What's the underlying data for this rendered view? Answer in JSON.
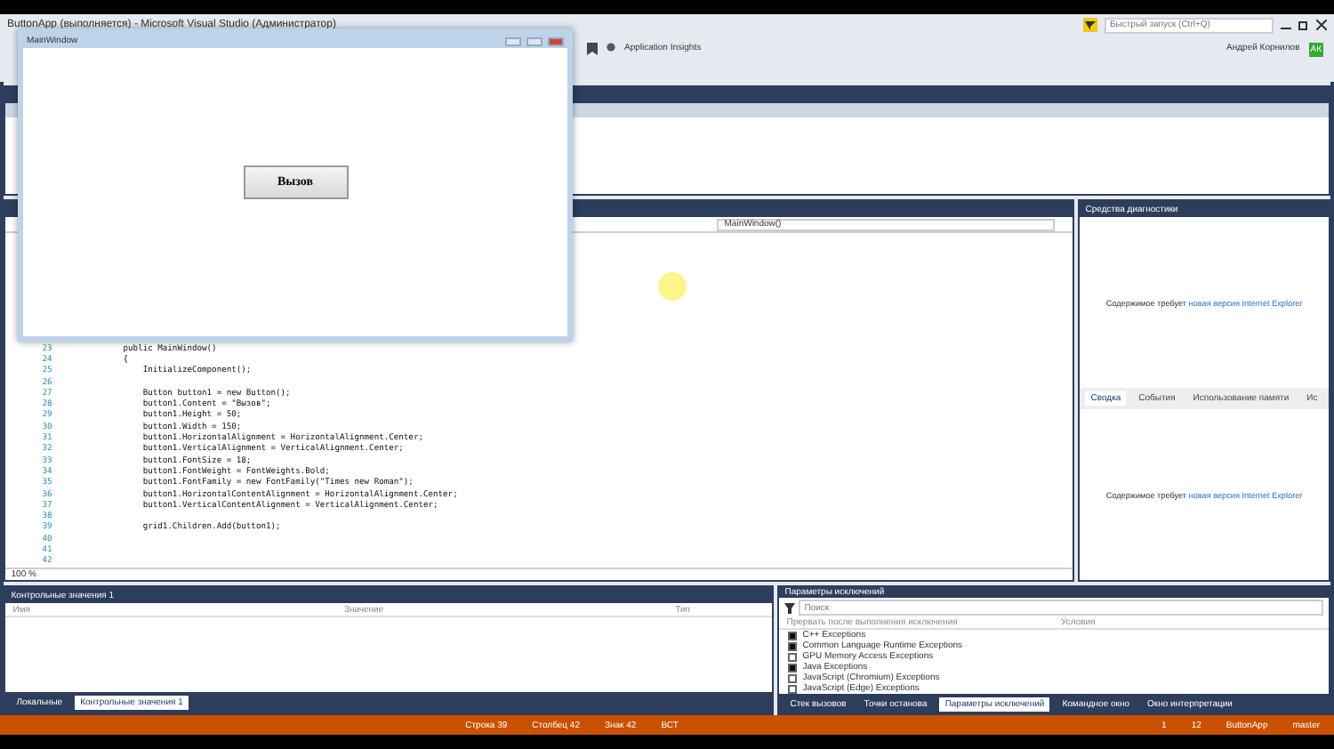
{
  "title": "ButtonApp (выполняется) - Microsoft Visual Studio (Администратор)",
  "search": {
    "placeholder": "Быстрый запуск (Ctrl+Q)"
  },
  "toolbar": {
    "app_insights": "Application Insights"
  },
  "user": {
    "name": "Андрей Корнилов",
    "initials": "АК"
  },
  "overlay_window": {
    "title": "MainWindow",
    "button": "Вызов"
  },
  "editor": {
    "member_dropdown": "MainWindow()",
    "zoom": "100 %",
    "lines": [
      {
        "number": "23",
        "code": "public MainWindow()"
      },
      {
        "number": "24",
        "code": "{"
      },
      {
        "number": "25",
        "code": "    InitializeComponent();"
      },
      {
        "number": "26"
      },
      {
        "number": "27",
        "code": "    Button button1 = new Button();"
      },
      {
        "number": "28",
        "code": "    button1.Content = \"Вызов\";"
      },
      {
        "number": "29",
        "code": "    button1.Height = 50;"
      },
      {
        "number": "30",
        "code": "    button1.Width = 150;"
      },
      {
        "number": "31",
        "code": "    button1.HorizontalAlignment = HorizontalAlignment.Center;"
      },
      {
        "number": "32",
        "code": "    button1.VerticalAlignment = VerticalAlignment.Center;"
      },
      {
        "number": "33",
        "code": "    button1.FontSize = 18;"
      },
      {
        "number": "34",
        "code": "    button1.FontWeight = FontWeights.Bold;"
      },
      {
        "number": "35",
        "code": "    button1.FontFamily = new FontFamily(\"Times new Roman\");"
      },
      {
        "number": "36",
        "code": "    button1.HorizontalContentAlignment = HorizontalAlignment.Center;"
      },
      {
        "number": "37",
        "code": "    button1.VerticalContentAlignment = VerticalAlignment.Center;"
      },
      {
        "number": "38"
      },
      {
        "number": "39",
        "code": "    grid1.Children.Add(button1);"
      },
      {
        "number": "40"
      },
      {
        "number": "41"
      },
      {
        "number": "42"
      }
    ]
  },
  "diagnostics": {
    "title": "Средства диагностики",
    "message": "Содержимое требует",
    "link": "новая версия Internet Explorer",
    "tabs": [
      {
        "label": "Сводка",
        "selected": true
      },
      {
        "label": "События",
        "selected": false
      },
      {
        "label": "Использование памяти",
        "selected": false
      },
      {
        "label": "Ис",
        "selected": false
      }
    ],
    "message_2": "Содержимое требует",
    "link_2": "новая версия Internet Explorer"
  },
  "watch": {
    "title": "Контрольные значения 1",
    "columns": [
      "Имя",
      "Значение",
      "Тип"
    ],
    "tabs": [
      {
        "label": "Локальные",
        "selected": false
      },
      {
        "label": "Контрольные значения 1",
        "selected": true
      }
    ]
  },
  "exceptions": {
    "title": "Параметры исключений",
    "search_placeholder": "Поиск",
    "columns": [
      "Прервать после выполнения исключения",
      "Условия"
    ],
    "rows": [
      {
        "label": "C++ Exceptions",
        "checked": true
      },
      {
        "label": "Common Language Runtime Exceptions",
        "checked": true
      },
      {
        "label": "GPU Memory Access Exceptions",
        "checked": false
      },
      {
        "label": "Java Exceptions",
        "checked": true
      },
      {
        "label": "JavaScript (Chromium) Exceptions",
        "checked": false
      },
      {
        "label": "JavaScript (Edge) Exceptions",
        "checked": false
      }
    ],
    "tabs": [
      {
        "label": "Стек вызовов",
        "selected": false
      },
      {
        "label": "Точки останова",
        "selected": false
      },
      {
        "label": "Параметры исключений",
        "selected": true
      },
      {
        "label": "Командное окно",
        "selected": false
      },
      {
        "label": "Окно интерпретации",
        "selected": false
      }
    ]
  },
  "status_bar": {
    "line": "Строка 39",
    "column": "Столбец 42",
    "char": "Знак 42",
    "mode": "ВСТ",
    "up": "1",
    "edits": "12",
    "project": "ButtonApp",
    "branch": "master"
  }
}
